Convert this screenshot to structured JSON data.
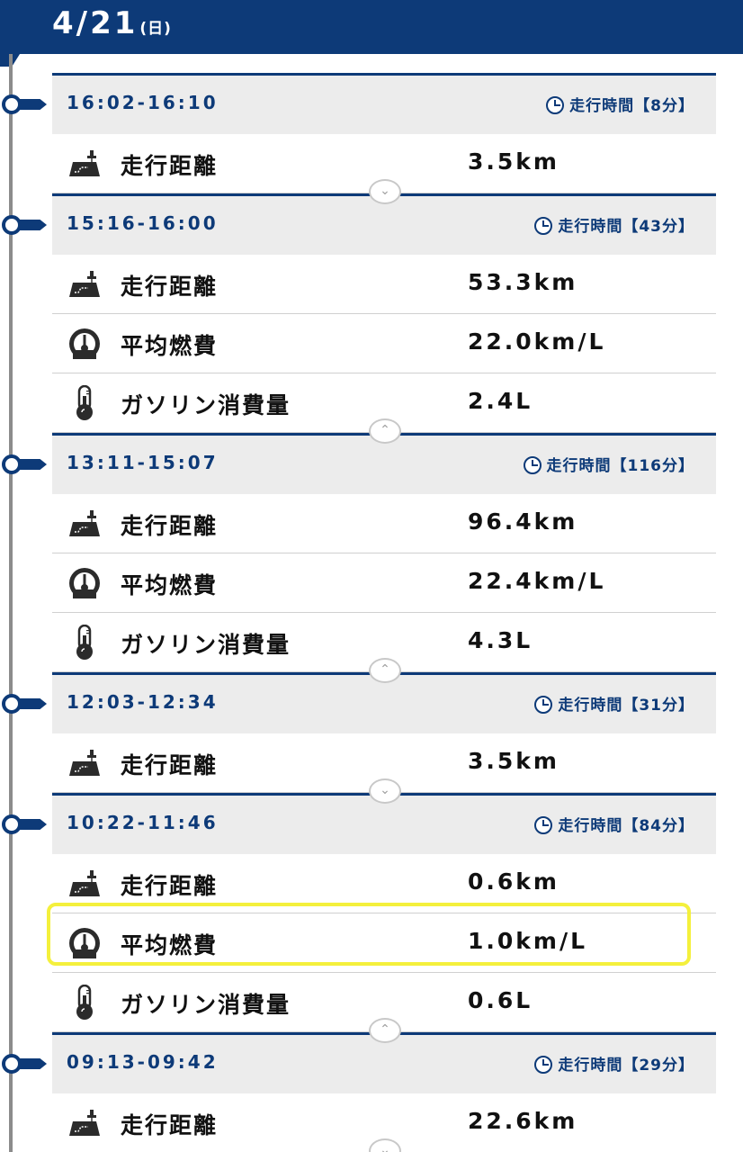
{
  "header": {
    "date": "4/21",
    "day_of_week": "(日)"
  },
  "labels": {
    "distance": "走行距離",
    "avg_fuel": "平均燃費",
    "fuel_used": "ガソリン消費量",
    "duration_prefix": "走行時間"
  },
  "trips": [
    {
      "time": "16:02-16:10",
      "duration": "【8分】",
      "distance": "3.5km",
      "toggle": "expand"
    },
    {
      "time": "15:16-16:00",
      "duration": "【43分】",
      "distance": "53.3km",
      "avg_fuel": "22.0km/L",
      "fuel_used": "2.4L",
      "toggle": "collapse"
    },
    {
      "time": "13:11-15:07",
      "duration": "【116分】",
      "distance": "96.4km",
      "avg_fuel": "22.4km/L",
      "fuel_used": "4.3L",
      "toggle": "collapse"
    },
    {
      "time": "12:03-12:34",
      "duration": "【31分】",
      "distance": "3.5km",
      "toggle": "expand"
    },
    {
      "time": "10:22-11:46",
      "duration": "【84分】",
      "distance": "0.6km",
      "avg_fuel": "1.0km/L",
      "fuel_used": "0.6L",
      "toggle": "collapse"
    },
    {
      "time": "09:13-09:42",
      "duration": "【29分】",
      "distance": "22.6km",
      "toggle": "expand"
    }
  ],
  "icons": {
    "distance": "map-distance-icon",
    "avg_fuel": "fuel-gauge-icon",
    "fuel_used": "fuel-thermometer-icon",
    "duration": "clock-icon",
    "toggle_expand": "chevron-down-icon",
    "toggle_collapse": "chevron-up-icon"
  },
  "colors": {
    "accent": "#0d3a78",
    "highlight": "#f4f03c",
    "header_bg": "#ececec"
  }
}
